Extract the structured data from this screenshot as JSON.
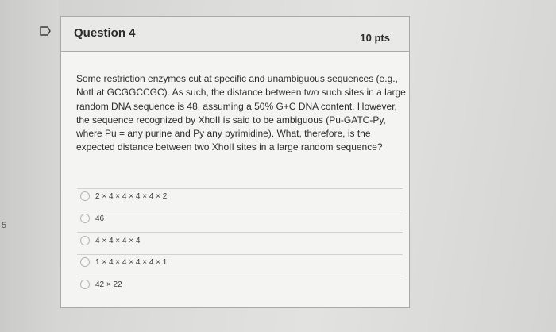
{
  "question": {
    "title": "Question 4",
    "points": "10 pts",
    "text": "Some restriction enzymes cut at specific and unambiguous sequences (e.g., NotI at GCGGCCGC). As such, the distance between two such sites in a large random DNA sequence is 48, assuming a 50% G+C DNA content. However, the sequence recognized by XhoII is said to be ambiguous (Pu-GATC-Py, where Pu = any purine and Py any pyrimidine). What, therefore, is the expected distance between two XhoII sites in a large random sequence?"
  },
  "answers": [
    {
      "label": "2 × 4 × 4 × 4 × 4 × 2"
    },
    {
      "label": "46"
    },
    {
      "label": "4 × 4 × 4 × 4"
    },
    {
      "label": "1 × 4 × 4 × 4 × 4 × 1"
    },
    {
      "label": "42 × 22"
    }
  ],
  "margin_char": "5",
  "icons": {
    "flag": "flag-icon",
    "radio": "radio-button"
  },
  "colors": {
    "flag_stroke": "#3a3a3a",
    "card_background": "#f4f4f2",
    "card_border": "#a9a9a7"
  }
}
